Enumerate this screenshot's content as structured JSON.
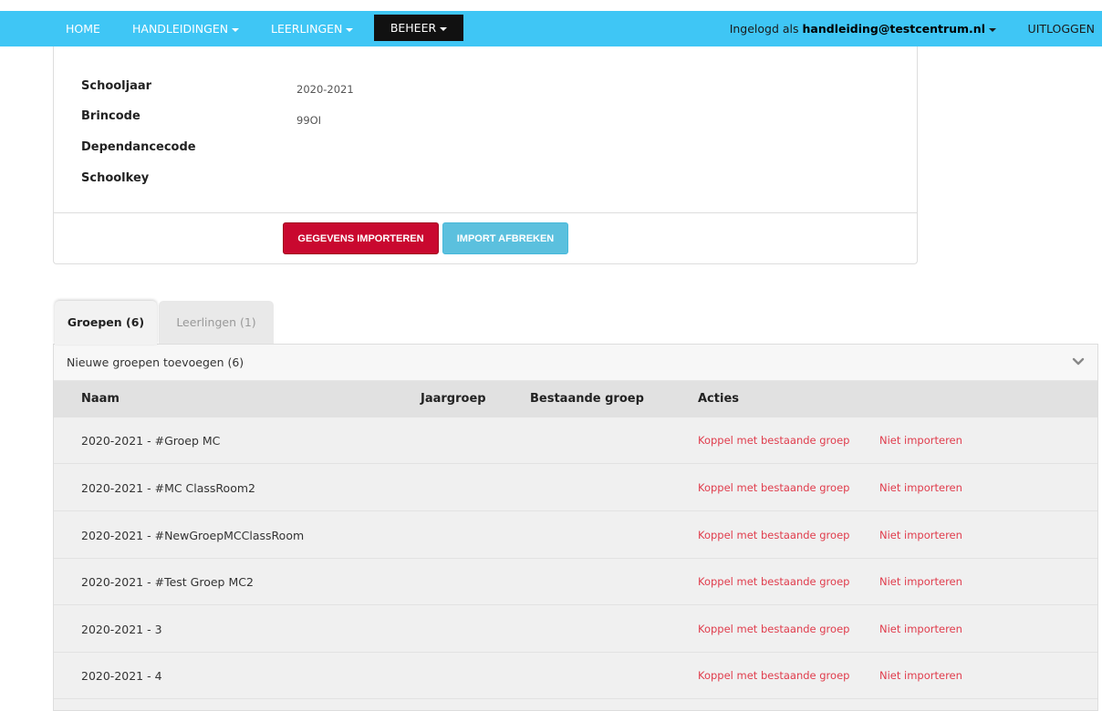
{
  "top_strip_text": "",
  "nav": {
    "home": "HOME",
    "handleidingen": "HANDLEIDINGEN",
    "leerlingen": "LEERLINGEN",
    "beheer": "BEHEER",
    "logged_in_prefix": "Ingelogd als ",
    "logged_in_user": "handleiding@testcentrum.nl",
    "logout": "UITLOGGEN",
    "accent_color": "#3fc6f5"
  },
  "details": {
    "fields": [
      {
        "label": "Schooljaar",
        "value": "2020-2021"
      },
      {
        "label": "Brincode",
        "value": "99OI"
      },
      {
        "label": "Dependancecode",
        "value": ""
      },
      {
        "label": "Schoolkey",
        "value": ""
      }
    ],
    "import_button": "GEGEVENS IMPORTEREN",
    "cancel_button": "IMPORT AFBREKEN"
  },
  "tabs": [
    {
      "label": "Groepen (6)",
      "active": true
    },
    {
      "label": "Leerlingen (1)",
      "active": false
    }
  ],
  "groups": {
    "section_title": "Nieuwe groepen toevoegen (6)",
    "columns": [
      "Naam",
      "Jaargroep",
      "Bestaande groep",
      "Acties"
    ],
    "rows": [
      {
        "name": "2020-2021 - #Groep MC",
        "action1": "Koppel met bestaande groep",
        "action2": "Niet importeren"
      },
      {
        "name": "2020-2021 - #MC ClassRoom2",
        "action1": "Koppel met bestaande groep",
        "action2": "Niet importeren"
      },
      {
        "name": "2020-2021 - #NewGroepMCClassRoom",
        "action1": "Koppel met bestaande groep",
        "action2": "Niet importeren"
      },
      {
        "name": "2020-2021 - #Test Groep MC2",
        "action1": "Koppel met bestaande groep",
        "action2": "Niet importeren"
      },
      {
        "name": "2020-2021 - 3",
        "action1": "Koppel met bestaande groep",
        "action2": "Niet importeren"
      },
      {
        "name": "2020-2021 - 4",
        "action1": "Koppel met bestaande groep",
        "action2": "Niet importeren"
      }
    ]
  }
}
